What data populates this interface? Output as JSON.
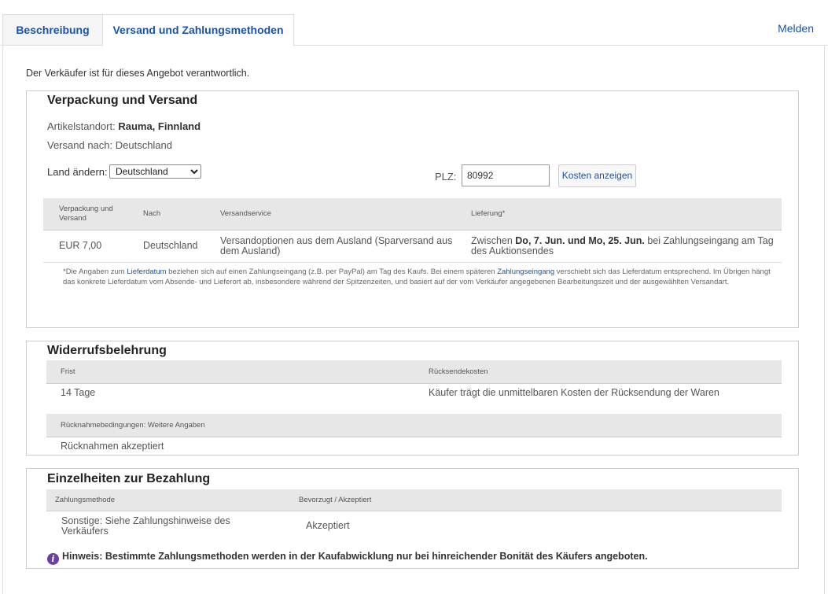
{
  "tabs": [
    {
      "label": "Beschreibung"
    },
    {
      "label": "Versand und Zahlungsmethoden"
    }
  ],
  "report_link": "Melden",
  "intro": "Der Verkäufer ist für dieses Angebot verantwortlich.",
  "shipping": {
    "title": "Verpackung und Versand",
    "location_label": "Artikelstandort: ",
    "location_value": "Rauma, Finnland",
    "ships_to": "Versand nach: Deutschland",
    "country_label": "Land ändern:",
    "country_selected": "Deutschland",
    "zip_label": "PLZ:",
    "zip_value": "80992",
    "show_costs_button": "Kosten anzeigen",
    "table": {
      "headers": [
        "Verpackung und Versand",
        "Nach",
        "Versandservice",
        "Lieferung*"
      ],
      "row": {
        "cost": "EUR 7,00",
        "to": "Deutschland",
        "service": "Versandoptionen aus dem Ausland (Sparversand aus dem Ausland)",
        "delivery_prefix": "Zwischen ",
        "delivery_dates": "Do, 7. Jun. und Mo, 25. Jun.",
        "delivery_suffix": " bei Zahlungseingang am Tag des Auktionsendes"
      }
    },
    "note": {
      "part1": "*Die Angaben zum ",
      "link1": "Lieferdatum",
      "part2": " beziehen sich auf einen Zahlungseingang (z.B. per PayPal) am Tag des Kaufs. Bei einem späteren ",
      "link2": "Zahlungseingang",
      "part3": " verschiebt sich das Lieferdatum entsprechend. Im Übrigen hängt das konkrete Lieferdatum vom Absende- und Lieferort ab, insbesondere während der Spitzenzeiten, und basiert auf der vom Verkäufer angegebenen Bearbeitungszeit und der ausgewählten Versandart."
    }
  },
  "returns": {
    "title": "Widerrufsbelehrung",
    "headers": [
      "Frist",
      "Rücksendekosten"
    ],
    "period": "14 Tage",
    "cost_text": "Käufer trägt die unmittelbaren Kosten der Rücksendung der Waren",
    "conditions_header": "Rücknahmebedingungen: Weitere Angaben",
    "conditions_value": "Rücknahmen akzeptiert"
  },
  "payment": {
    "title": "Einzelheiten zur Bezahlung",
    "headers": [
      "Zahlungsmethode",
      "Bevorzugt / Akzeptiert"
    ],
    "method": "Sonstige: Siehe Zahlungshinweise des Verkäufers",
    "status": "Akzeptiert",
    "hint": "Hinweis: Bestimmte Zahlungsmethoden werden in der Kaufabwicklung nur bei hinreichender Bonität des Käufers angeboten."
  },
  "colors": {
    "link": "#1b53a8",
    "info_icon": "#6d3fa6",
    "table_header": "#e7e7e7"
  }
}
